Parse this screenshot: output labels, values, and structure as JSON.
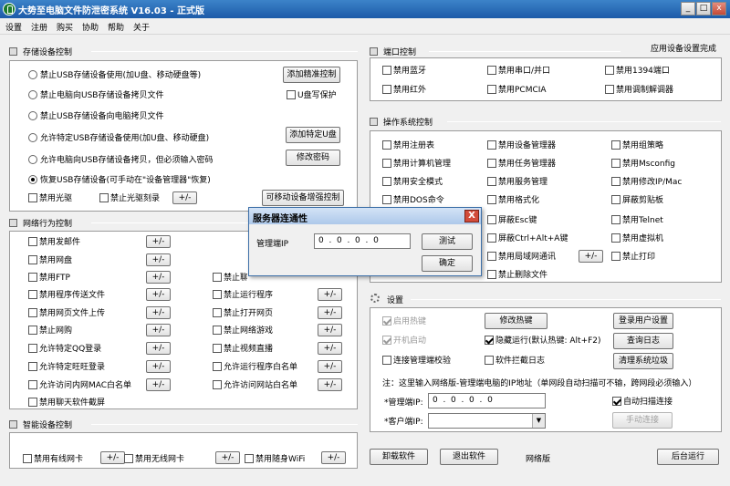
{
  "window": {
    "title": "大势至电脑文件防泄密系统 V16.03 - 正式版",
    "min": "0",
    "max": "1",
    "close": "r"
  },
  "menu": [
    "设置",
    "注册",
    "购买",
    "协助",
    "帮助",
    "关于"
  ],
  "storage": {
    "title": "存储设备控制",
    "radios": [
      "禁止USB存储设备使用(加U盘、移动硬盘等)",
      "禁止电脑向USB存储设备拷贝文件",
      "禁止USB存储设备向电脑拷贝文件",
      "允许特定USB存储设备使用(加U盘、移动硬盘)",
      "允许电脑向USB存储设备拷贝，但必须输入密码",
      "恢复USB存储设备(可手动在\"设备管理器\"恢复)"
    ],
    "btn_precise": "添加精准控制",
    "udisk_wp": "U盘写保护",
    "btn_add_udisk": "添加特定U盘",
    "btn_change_pwd": "修改密码",
    "disable_cd": "禁用光驱",
    "disable_burn": "禁止光驱刻录",
    "pm": "+/-",
    "btn_mobile": "可移动设备增强控制"
  },
  "network": {
    "title": "网络行为控制",
    "pm": "+/-",
    "left": [
      "禁用发邮件",
      "禁用网盘",
      "禁用FTP",
      "禁用程序传送文件",
      "禁用网页文件上传",
      "禁止网购",
      "允许特定QQ登录",
      "允许特定旺旺登录",
      "允许访问内网MAC白名单",
      "禁用聊天软件截屏"
    ],
    "right": [
      "禁止聊天",
      "禁止运行程序",
      "禁止打开网页",
      "禁止网络游戏",
      "禁止视频直播",
      "允许运行程序白名单",
      "允许访问网站白名单"
    ]
  },
  "smart": {
    "title": "智能设备控制",
    "items": [
      "禁用有线网卡",
      "禁用无线网卡",
      "禁用随身WiFi"
    ],
    "pm": "+/-"
  },
  "port": {
    "title": "端口控制",
    "app_status": "应用设备设置完成",
    "items": [
      "禁用蓝牙",
      "禁用串口/并口",
      "禁用1394端口",
      "禁用红外",
      "禁用PCMCIA",
      "禁用调制解调器"
    ]
  },
  "os": {
    "title": "操作系统控制",
    "pm": "+/-",
    "col1": [
      "禁用注册表",
      "禁用计算机管理",
      "禁用安全模式",
      "禁用DOS命令"
    ],
    "col2": [
      "禁用设备管理器",
      "禁用任务管理器",
      "禁用服务管理",
      "禁用格式化",
      "屏蔽Esc键",
      "屏蔽Ctrl+Alt+A键",
      "禁用局域网通讯",
      "禁止删除文件"
    ],
    "col3": [
      "禁用组策略",
      "禁用Msconfig",
      "禁用修改IP/Mac",
      "屏蔽剪贴板",
      "禁用Telnet",
      "禁用虚拟机",
      "禁止打印"
    ]
  },
  "settings": {
    "title": "设置",
    "hotkey": "启用热键",
    "autostart": "开机启动",
    "mgmt_verify": "连接管理端校验",
    "btn_hotkey": "修改热键",
    "hide_run": "隐藏运行(默认热键: Alt+F2)",
    "soft_log": "软件拦截日志",
    "btn_login": "登录用户设置",
    "btn_log": "查询日志",
    "btn_clean": "清理系统垃圾",
    "note": "注：这里输入网络版-管理端电脑的IP地址（单网段自动扫描可不输，跨网段必须输入）",
    "mgmt_ip_label": "*管理端IP:",
    "mgmt_ip": "0  .  0  .  0  .  0",
    "auto_scan": "自动扫描连接",
    "client_ip_label": "*客户端IP:",
    "btn_manual": "手动连接"
  },
  "footer": {
    "uninstall": "卸载软件",
    "exit": "退出软件",
    "edition": "网络版",
    "background": "后台运行"
  },
  "dialog": {
    "title": "服务器连通性",
    "ip_label": "管理端IP",
    "ip": "0  .  0  .  0  .  0",
    "test": "测试",
    "ok": "确定",
    "close": "X"
  }
}
